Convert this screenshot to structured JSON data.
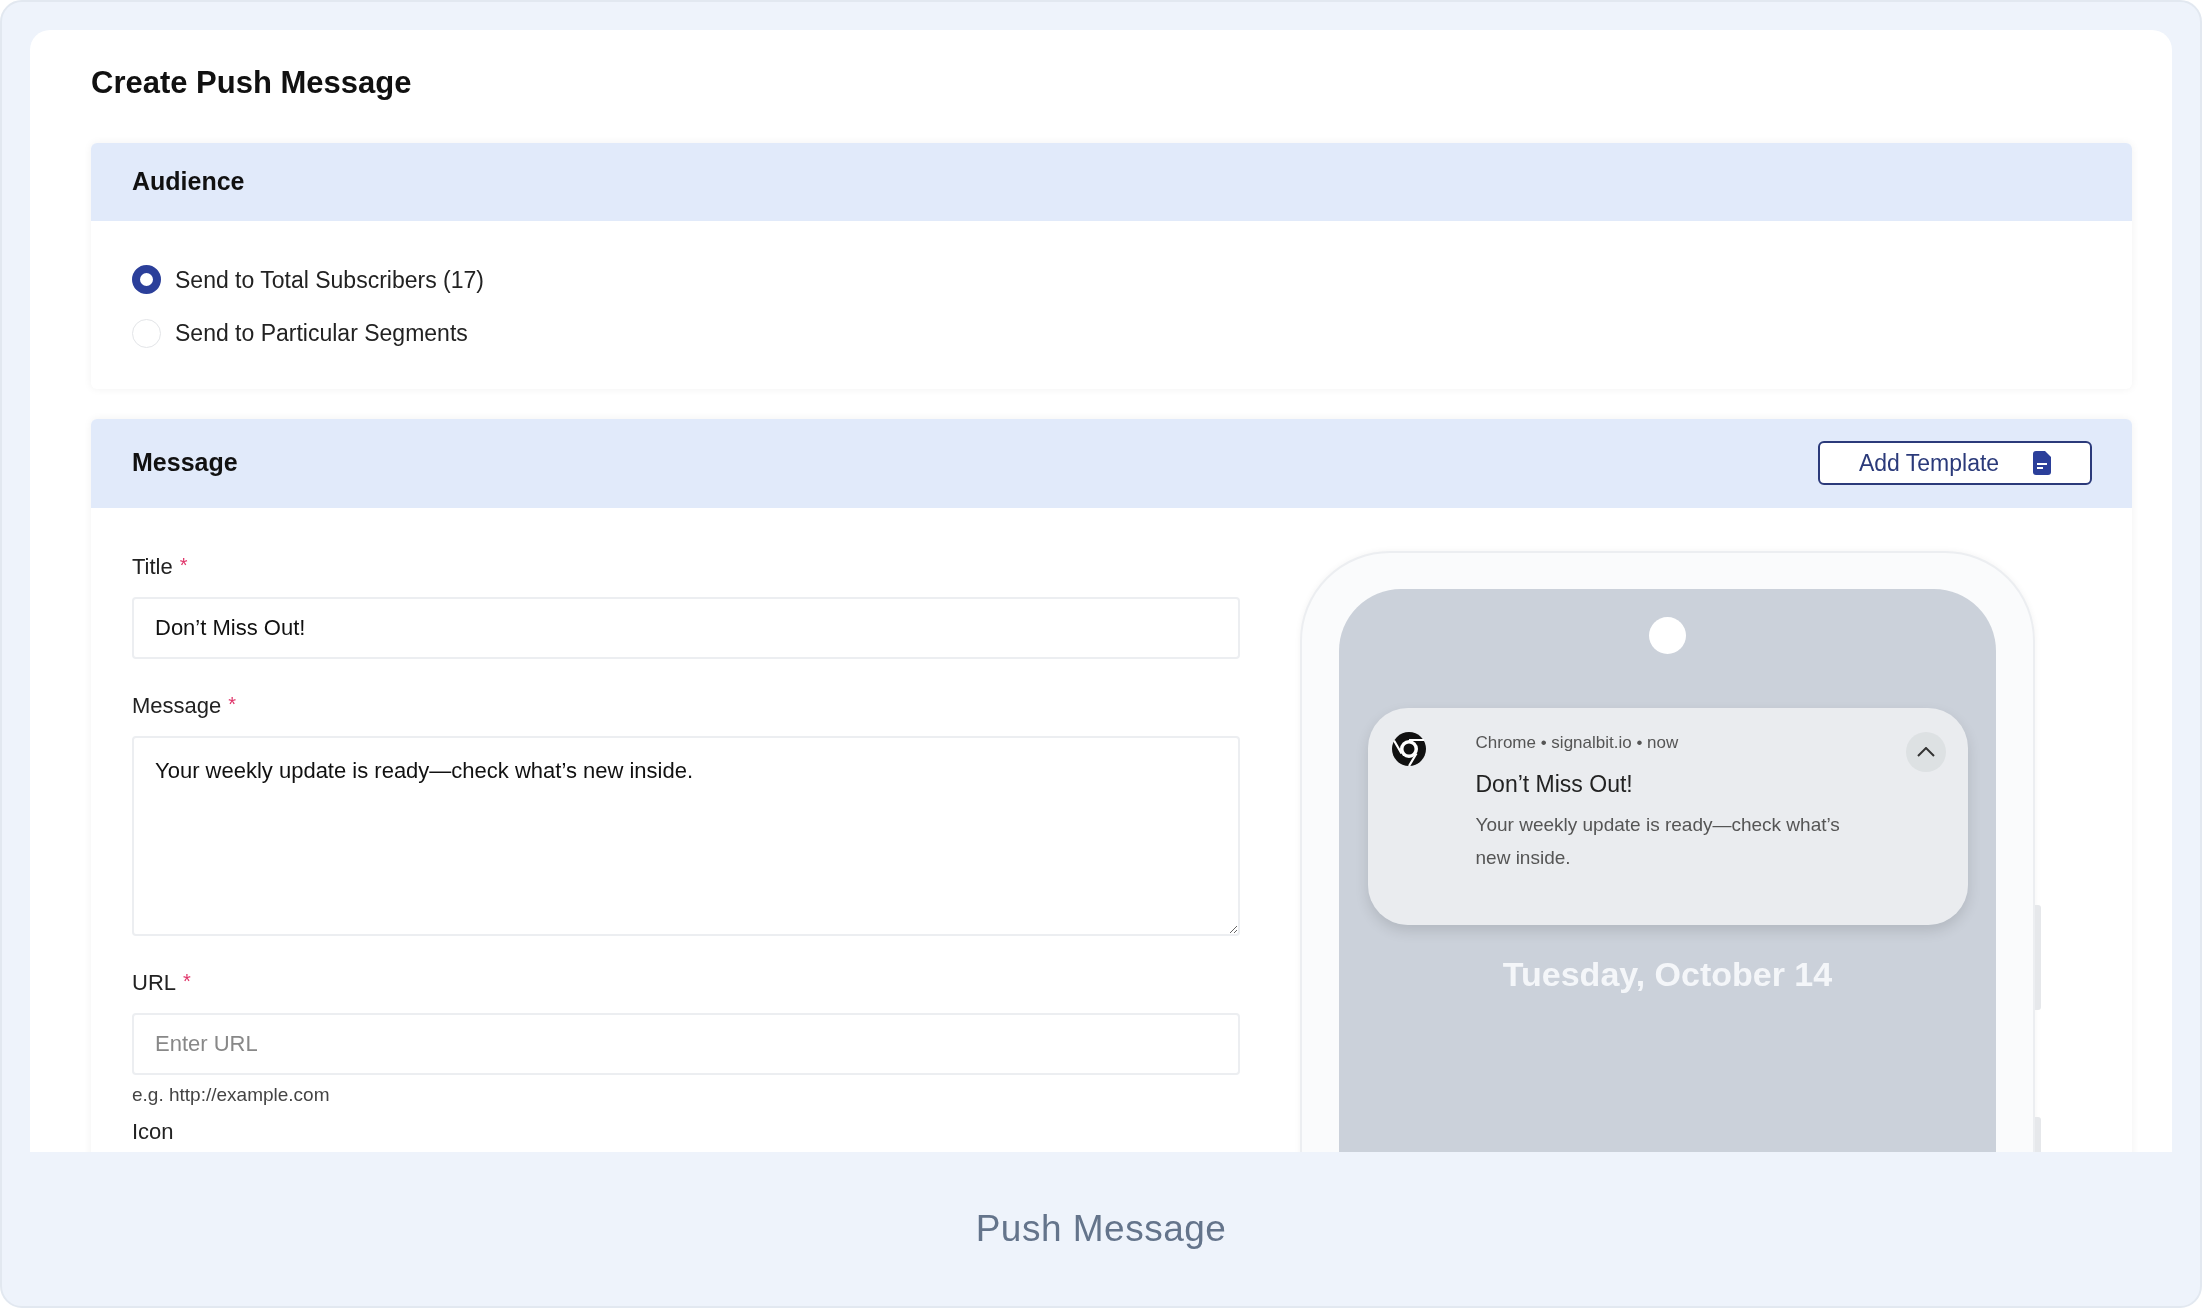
{
  "page": {
    "title": "Create Push Message"
  },
  "audience": {
    "heading": "Audience",
    "options": [
      {
        "label": "Send to Total Subscribers (17)",
        "selected": true
      },
      {
        "label": "Send to Particular Segments",
        "selected": false
      }
    ]
  },
  "message": {
    "heading": "Message",
    "add_template_button": "Add Template",
    "fields": [
      {
        "kind": "input",
        "label": "Title",
        "required_mark": "*",
        "value": "Don’t Miss Out!"
      },
      {
        "kind": "textarea",
        "label": "Message",
        "required_mark": "*",
        "value": "Your weekly update is ready—check what’s new inside."
      },
      {
        "kind": "input",
        "label": "URL",
        "required_mark": "*",
        "placeholder": "Enter URL",
        "hint": "e.g. http://example.com"
      },
      {
        "kind": "label",
        "label": "Icon"
      }
    ]
  },
  "preview": {
    "date": "Tuesday, October 14",
    "notification": {
      "source": "Chrome • signalbit.io • now",
      "title": "Don’t Miss Out!",
      "body": "Your weekly update is ready—check what’s new inside."
    }
  },
  "caption": "Push Message"
}
